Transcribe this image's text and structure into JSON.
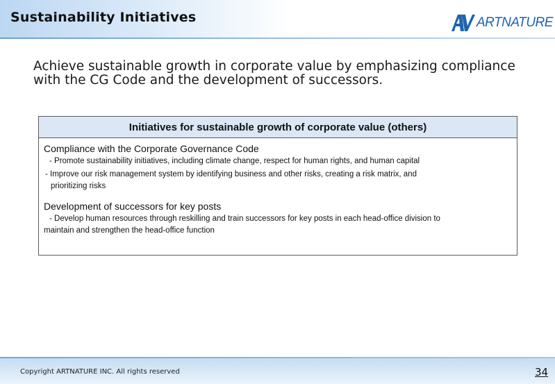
{
  "header": {
    "title": "Sustainability Initiatives",
    "logo_text": "ARTNATURE",
    "logo_mark": "AV"
  },
  "lead": "Achieve sustainable growth in corporate value by emphasizing compliance with the CG Code and the development of successors.",
  "panel": {
    "heading": "Initiatives for sustainable growth of corporate value (others)",
    "sections": [
      {
        "title": "Compliance with the Corporate Governance Code",
        "bullets": [
          "- Promote sustainability initiatives, including climate change, respect for human rights, and human capital",
          "- Improve our risk management system by identifying business and other risks, creating a risk matrix, and",
          "prioritizing risks"
        ]
      },
      {
        "title": "Development of successors for key posts",
        "bullets": [
          "- Develop human resources through reskilling and train successors for key posts in each head-office division to",
          "maintain and strengthen the head-office function"
        ]
      }
    ]
  },
  "footer": {
    "copyright": "Copyright ARTNATURE INC. All rights reserved",
    "page_number": "34"
  },
  "colors": {
    "brand_blue": "#1b64b0",
    "header_gradient": "#bcd7f2",
    "panel_header_bg": "#dbe7f5"
  }
}
